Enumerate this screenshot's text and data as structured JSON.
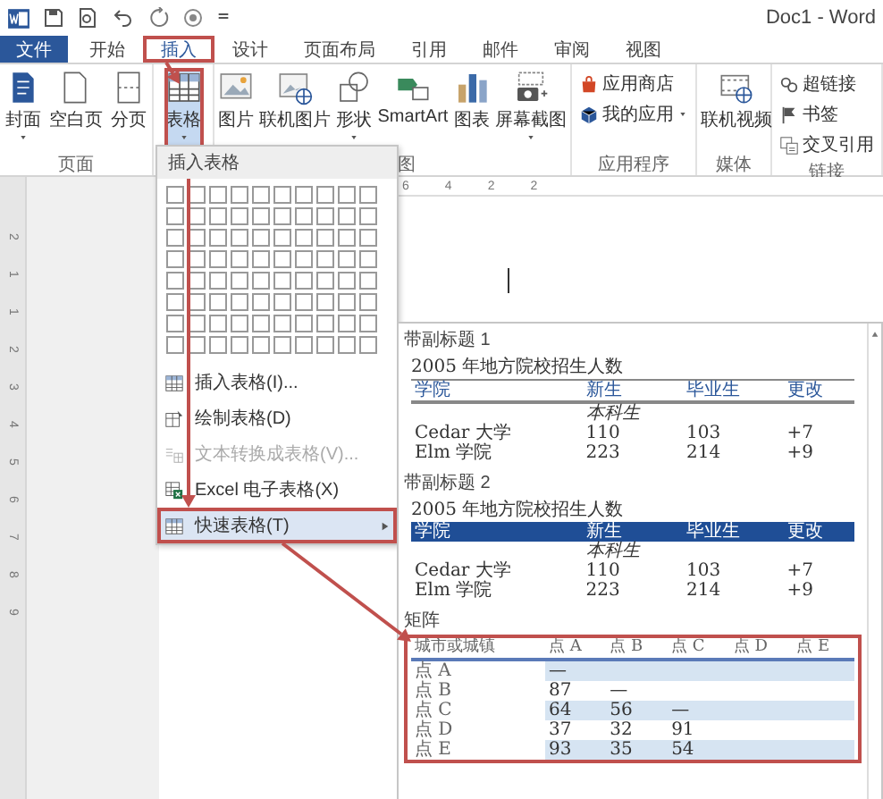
{
  "window": {
    "title": "Doc1 - Word"
  },
  "tabs": [
    {
      "label": "文件",
      "kind": "file",
      "selected": false,
      "annotated": false
    },
    {
      "label": "开始",
      "kind": "tab",
      "selected": false,
      "annotated": false
    },
    {
      "label": "插入",
      "kind": "tab",
      "selected": true,
      "annotated": true
    },
    {
      "label": "设计",
      "kind": "tab",
      "selected": false,
      "annotated": false
    },
    {
      "label": "页面布局",
      "kind": "tab",
      "selected": false,
      "annotated": false
    },
    {
      "label": "引用",
      "kind": "tab",
      "selected": false,
      "annotated": false
    },
    {
      "label": "邮件",
      "kind": "tab",
      "selected": false,
      "annotated": false
    },
    {
      "label": "审阅",
      "kind": "tab",
      "selected": false,
      "annotated": false
    },
    {
      "label": "视图",
      "kind": "tab",
      "selected": false,
      "annotated": false
    }
  ],
  "ribbon": [
    {
      "label": "页面",
      "commands": [
        {
          "label": "封面",
          "kind": "large",
          "dropdown": true,
          "selected": false,
          "annotated": false
        },
        {
          "label": "空白页",
          "kind": "large",
          "dropdown": false,
          "selected": false,
          "annotated": false
        },
        {
          "label": "分页",
          "kind": "large",
          "dropdown": false,
          "selected": false,
          "annotated": false
        }
      ]
    },
    {
      "commands": [
        {
          "label": "表格",
          "kind": "large",
          "dropdown": true,
          "selected": true,
          "annotated": true
        }
      ]
    },
    {
      "label": "图",
      "commands": [
        {
          "label": "图片",
          "kind": "large",
          "dropdown": false,
          "selected": false,
          "annotated": false
        },
        {
          "label": "联机图片",
          "kind": "large",
          "dropdown": false,
          "selected": false,
          "annotated": false
        },
        {
          "label": "形状",
          "kind": "large",
          "dropdown": true,
          "selected": false,
          "annotated": false
        },
        {
          "label": "SmartArt",
          "kind": "large",
          "dropdown": false,
          "selected": false,
          "annotated": false
        },
        {
          "label": "图表",
          "kind": "large",
          "dropdown": false,
          "selected": false,
          "annotated": false
        },
        {
          "label": "屏幕截图",
          "kind": "large",
          "dropdown": true,
          "selected": false,
          "annotated": false
        }
      ]
    },
    {
      "label": "应用程序",
      "commands": [
        {
          "label": "应用商店",
          "kind": "small",
          "dropdown": false,
          "selected": false,
          "annotated": false
        },
        {
          "label": "我的应用",
          "kind": "small",
          "dropdown": true,
          "selected": false,
          "annotated": false
        }
      ]
    },
    {
      "label": "媒体",
      "commands": [
        {
          "label": "联机视频",
          "kind": "large",
          "dropdown": false,
          "selected": false,
          "annotated": false
        }
      ]
    },
    {
      "label": "链接",
      "commands": [
        {
          "label": "超链接",
          "kind": "small",
          "dropdown": false,
          "selected": false,
          "annotated": false
        },
        {
          "label": "书签",
          "kind": "small",
          "dropdown": false,
          "selected": false,
          "annotated": false
        },
        {
          "label": "交叉引用",
          "kind": "small",
          "dropdown": false,
          "selected": false,
          "annotated": false
        }
      ]
    }
  ],
  "ruler": {
    "horizontal": [
      "6",
      "4",
      "2",
      "2"
    ],
    "vertical": [
      "2",
      "1",
      "1",
      "2",
      "3",
      "4",
      "5",
      "6",
      "7",
      "8",
      "9"
    ]
  },
  "table_menu": {
    "header": "插入表格",
    "items": [
      {
        "label": "插入表格(I)...",
        "disabled": false,
        "highlighted": false,
        "annotated": false,
        "submenu": false
      },
      {
        "label": "绘制表格(D)",
        "disabled": false,
        "highlighted": false,
        "annotated": false,
        "submenu": false
      },
      {
        "label": "文本转换成表格(V)...",
        "disabled": true,
        "highlighted": false,
        "annotated": false,
        "submenu": false
      },
      {
        "label": "Excel 电子表格(X)",
        "disabled": false,
        "highlighted": false,
        "annotated": false,
        "submenu": false
      },
      {
        "label": "快速表格(T)",
        "disabled": false,
        "highlighted": true,
        "annotated": true,
        "submenu": true
      }
    ]
  },
  "quick_tables": [
    {
      "title": "带副标题 1",
      "kind": "plain",
      "annotated": false,
      "caption": "2005 年地方院校招生人数",
      "columns": [
        "学院",
        "新生",
        "毕业生",
        "更改"
      ],
      "subheader": "本科生",
      "rows": [
        [
          "Cedar 大学",
          "110",
          "103",
          "+7"
        ],
        [
          "Elm 学院",
          "223",
          "214",
          "+9"
        ]
      ]
    },
    {
      "title": "带副标题 2",
      "kind": "banded_header",
      "annotated": false,
      "caption": "2005 年地方院校招生人数",
      "columns": [
        "学院",
        "新生",
        "毕业生",
        "更改"
      ],
      "subheader": "本科生",
      "rows": [
        [
          "Cedar 大学",
          "110",
          "103",
          "+7"
        ],
        [
          "Elm 学院",
          "223",
          "214",
          "+9"
        ]
      ]
    },
    {
      "title": "矩阵",
      "kind": "matrix",
      "annotated": true,
      "columns": [
        "城市或城镇",
        "点 A",
        "点 B",
        "点 C",
        "点 D",
        "点 E"
      ],
      "rows": [
        [
          "点 A",
          "—"
        ],
        [
          "点 B",
          "87",
          "—"
        ],
        [
          "点 C",
          "64",
          "56",
          "—"
        ],
        [
          "点 D",
          "37",
          "32",
          "91"
        ],
        [
          "点 E",
          "93",
          "35",
          "54"
        ]
      ]
    }
  ]
}
